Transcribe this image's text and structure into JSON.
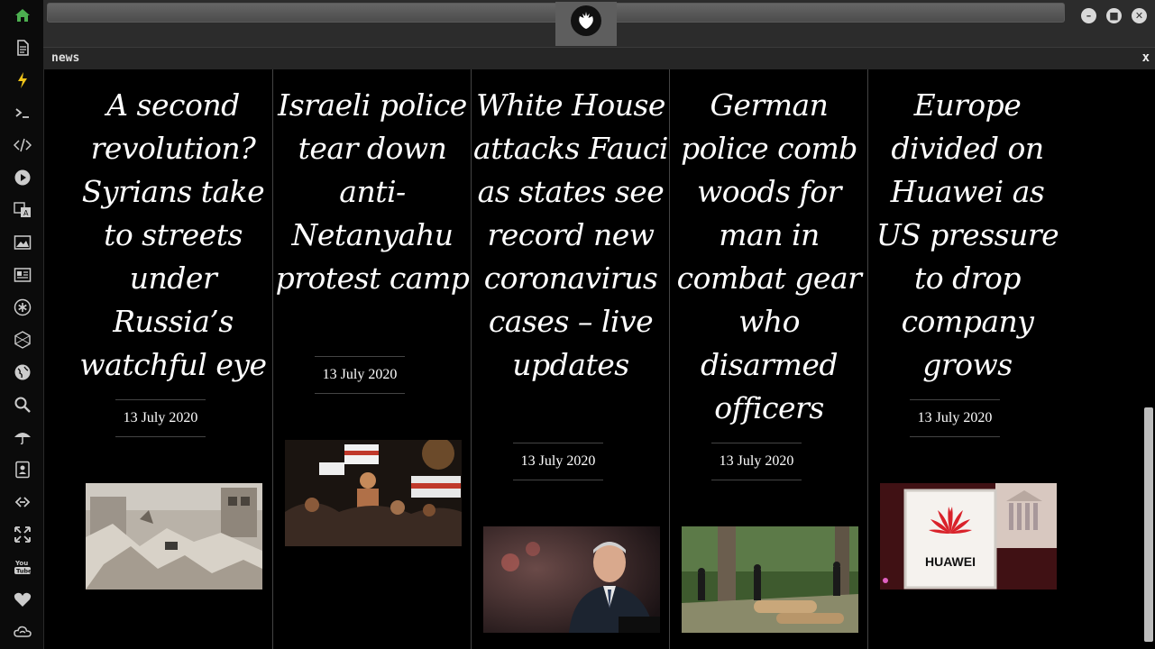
{
  "tab": {
    "title": "news",
    "close": "x"
  },
  "window": {
    "minimize": "–",
    "maximize": "■",
    "close": "✕"
  },
  "sidebar": [
    {
      "name": "home-icon"
    },
    {
      "name": "document-icon"
    },
    {
      "name": "lightning-icon"
    },
    {
      "name": "terminal-icon"
    },
    {
      "name": "code-icon"
    },
    {
      "name": "play-icon"
    },
    {
      "name": "translate-icon"
    },
    {
      "name": "image-icon"
    },
    {
      "name": "news-icon"
    },
    {
      "name": "asterisk-icon"
    },
    {
      "name": "hexagon-icon"
    },
    {
      "name": "globe-icon"
    },
    {
      "name": "search-icon"
    },
    {
      "name": "umbrella-icon"
    },
    {
      "name": "contacts-icon"
    },
    {
      "name": "link-icon"
    },
    {
      "name": "expand-icon"
    },
    {
      "name": "youtube-icon"
    },
    {
      "name": "heart-icon"
    },
    {
      "name": "cloud-icon"
    }
  ],
  "articles": [
    {
      "headline": "A second revolution? Syrians take to streets under Russia’s watchful eye",
      "date": "13 July 2020",
      "image": "rubble-photo"
    },
    {
      "headline": "Israeli police tear down anti-Netanyahu protest camp",
      "date": "13 July 2020",
      "image": "protest-photo"
    },
    {
      "headline": "White House attacks Fauci as states see record new coronavirus cases – live updates",
      "date": "13 July 2020",
      "image": "fauci-photo"
    },
    {
      "headline": "German police comb woods for man in combat gear who disarmed officers",
      "date": "13 July 2020",
      "image": "forest-police-photo"
    },
    {
      "headline": "Europe divided on Huawei as US pressure to drop company grows",
      "date": "13 July 2020",
      "image": "huawei-photo",
      "image_text": "HUAWEI"
    }
  ],
  "colors": {
    "accent_active": "#4caf50",
    "background": "#000000",
    "panel": "#2c2c2c"
  }
}
